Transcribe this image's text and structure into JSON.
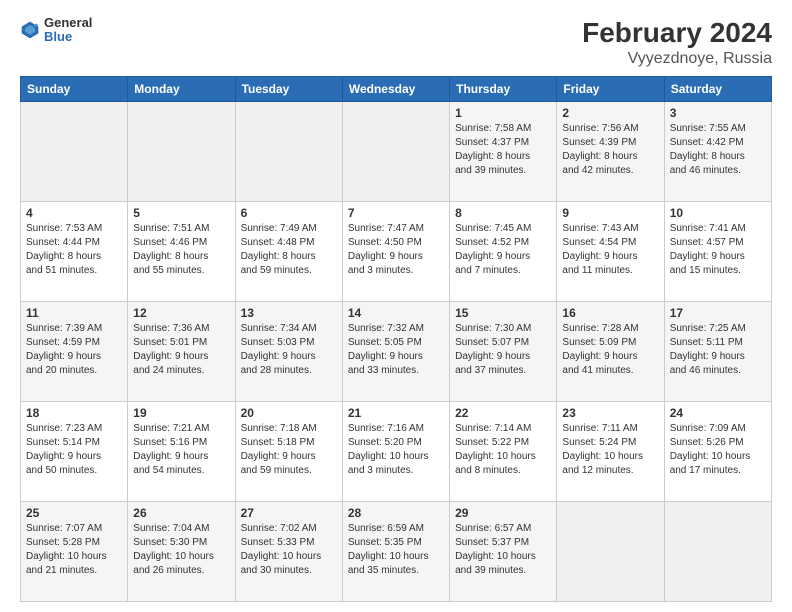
{
  "header": {
    "logo": {
      "general": "General",
      "blue": "Blue"
    },
    "title": "February 2024",
    "subtitle": "Vyyezdnoye, Russia"
  },
  "calendar": {
    "days_of_week": [
      "Sunday",
      "Monday",
      "Tuesday",
      "Wednesday",
      "Thursday",
      "Friday",
      "Saturday"
    ],
    "weeks": [
      [
        {
          "day": "",
          "info": ""
        },
        {
          "day": "",
          "info": ""
        },
        {
          "day": "",
          "info": ""
        },
        {
          "day": "",
          "info": ""
        },
        {
          "day": "1",
          "info": "Sunrise: 7:58 AM\nSunset: 4:37 PM\nDaylight: 8 hours\nand 39 minutes."
        },
        {
          "day": "2",
          "info": "Sunrise: 7:56 AM\nSunset: 4:39 PM\nDaylight: 8 hours\nand 42 minutes."
        },
        {
          "day": "3",
          "info": "Sunrise: 7:55 AM\nSunset: 4:42 PM\nDaylight: 8 hours\nand 46 minutes."
        }
      ],
      [
        {
          "day": "4",
          "info": "Sunrise: 7:53 AM\nSunset: 4:44 PM\nDaylight: 8 hours\nand 51 minutes."
        },
        {
          "day": "5",
          "info": "Sunrise: 7:51 AM\nSunset: 4:46 PM\nDaylight: 8 hours\nand 55 minutes."
        },
        {
          "day": "6",
          "info": "Sunrise: 7:49 AM\nSunset: 4:48 PM\nDaylight: 8 hours\nand 59 minutes."
        },
        {
          "day": "7",
          "info": "Sunrise: 7:47 AM\nSunset: 4:50 PM\nDaylight: 9 hours\nand 3 minutes."
        },
        {
          "day": "8",
          "info": "Sunrise: 7:45 AM\nSunset: 4:52 PM\nDaylight: 9 hours\nand 7 minutes."
        },
        {
          "day": "9",
          "info": "Sunrise: 7:43 AM\nSunset: 4:54 PM\nDaylight: 9 hours\nand 11 minutes."
        },
        {
          "day": "10",
          "info": "Sunrise: 7:41 AM\nSunset: 4:57 PM\nDaylight: 9 hours\nand 15 minutes."
        }
      ],
      [
        {
          "day": "11",
          "info": "Sunrise: 7:39 AM\nSunset: 4:59 PM\nDaylight: 9 hours\nand 20 minutes."
        },
        {
          "day": "12",
          "info": "Sunrise: 7:36 AM\nSunset: 5:01 PM\nDaylight: 9 hours\nand 24 minutes."
        },
        {
          "day": "13",
          "info": "Sunrise: 7:34 AM\nSunset: 5:03 PM\nDaylight: 9 hours\nand 28 minutes."
        },
        {
          "day": "14",
          "info": "Sunrise: 7:32 AM\nSunset: 5:05 PM\nDaylight: 9 hours\nand 33 minutes."
        },
        {
          "day": "15",
          "info": "Sunrise: 7:30 AM\nSunset: 5:07 PM\nDaylight: 9 hours\nand 37 minutes."
        },
        {
          "day": "16",
          "info": "Sunrise: 7:28 AM\nSunset: 5:09 PM\nDaylight: 9 hours\nand 41 minutes."
        },
        {
          "day": "17",
          "info": "Sunrise: 7:25 AM\nSunset: 5:11 PM\nDaylight: 9 hours\nand 46 minutes."
        }
      ],
      [
        {
          "day": "18",
          "info": "Sunrise: 7:23 AM\nSunset: 5:14 PM\nDaylight: 9 hours\nand 50 minutes."
        },
        {
          "day": "19",
          "info": "Sunrise: 7:21 AM\nSunset: 5:16 PM\nDaylight: 9 hours\nand 54 minutes."
        },
        {
          "day": "20",
          "info": "Sunrise: 7:18 AM\nSunset: 5:18 PM\nDaylight: 9 hours\nand 59 minutes."
        },
        {
          "day": "21",
          "info": "Sunrise: 7:16 AM\nSunset: 5:20 PM\nDaylight: 10 hours\nand 3 minutes."
        },
        {
          "day": "22",
          "info": "Sunrise: 7:14 AM\nSunset: 5:22 PM\nDaylight: 10 hours\nand 8 minutes."
        },
        {
          "day": "23",
          "info": "Sunrise: 7:11 AM\nSunset: 5:24 PM\nDaylight: 10 hours\nand 12 minutes."
        },
        {
          "day": "24",
          "info": "Sunrise: 7:09 AM\nSunset: 5:26 PM\nDaylight: 10 hours\nand 17 minutes."
        }
      ],
      [
        {
          "day": "25",
          "info": "Sunrise: 7:07 AM\nSunset: 5:28 PM\nDaylight: 10 hours\nand 21 minutes."
        },
        {
          "day": "26",
          "info": "Sunrise: 7:04 AM\nSunset: 5:30 PM\nDaylight: 10 hours\nand 26 minutes."
        },
        {
          "day": "27",
          "info": "Sunrise: 7:02 AM\nSunset: 5:33 PM\nDaylight: 10 hours\nand 30 minutes."
        },
        {
          "day": "28",
          "info": "Sunrise: 6:59 AM\nSunset: 5:35 PM\nDaylight: 10 hours\nand 35 minutes."
        },
        {
          "day": "29",
          "info": "Sunrise: 6:57 AM\nSunset: 5:37 PM\nDaylight: 10 hours\nand 39 minutes."
        },
        {
          "day": "",
          "info": ""
        },
        {
          "day": "",
          "info": ""
        }
      ]
    ]
  }
}
